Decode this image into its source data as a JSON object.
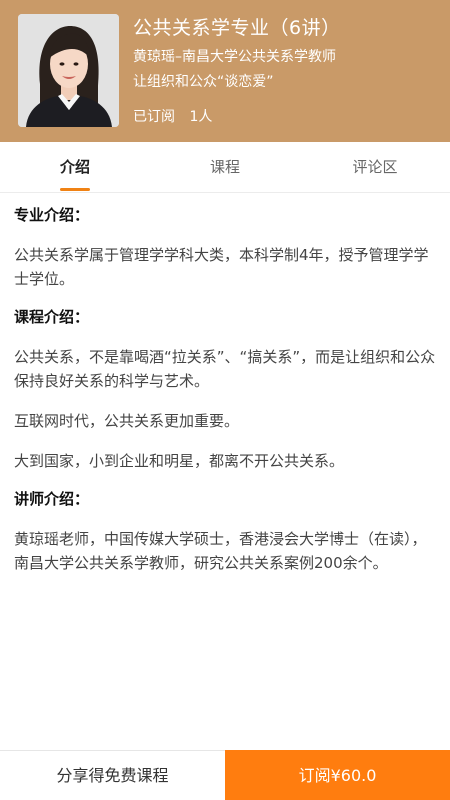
{
  "header": {
    "title": "公共关系学专业（6讲）",
    "teacher": "黄琼瑶–南昌大学公共关系学教师",
    "slogan": "让组织和公众“谈恋爱”",
    "subscribed_label": "已订阅",
    "subscribed_count": "1人"
  },
  "tabs": [
    {
      "label": "介绍",
      "active": true
    },
    {
      "label": "课程",
      "active": false
    },
    {
      "label": "评论区",
      "active": false
    }
  ],
  "intro": {
    "major_title": "专业介绍：",
    "major_text": "公共关系学属于管理学学科大类，本科学制4年，授予管理学学士学位。",
    "course_title": "课程介绍：",
    "course_p1": "公共关系，不是靠喝酒“拉关系”、“搞关系”，而是让组织和公众保持良好关系的科学与艺术。",
    "course_p2": "互联网时代，公共关系更加重要。",
    "course_p3": "大到国家，小到企业和明星，都离不开公共关系。",
    "teacher_title": "讲师介绍：",
    "teacher_text": "黄琼瑶老师，中国传媒大学硕士，香港浸会大学博士（在读），南昌大学公共关系学教师，研究公共关系案例200余个。"
  },
  "bottom": {
    "share_label": "分享得免费课程",
    "subscribe_label": "订阅¥60.0"
  },
  "colors": {
    "header_bg": "#c99a68",
    "accent": "#f08214",
    "subscribe_bg": "#ff7d0f"
  }
}
